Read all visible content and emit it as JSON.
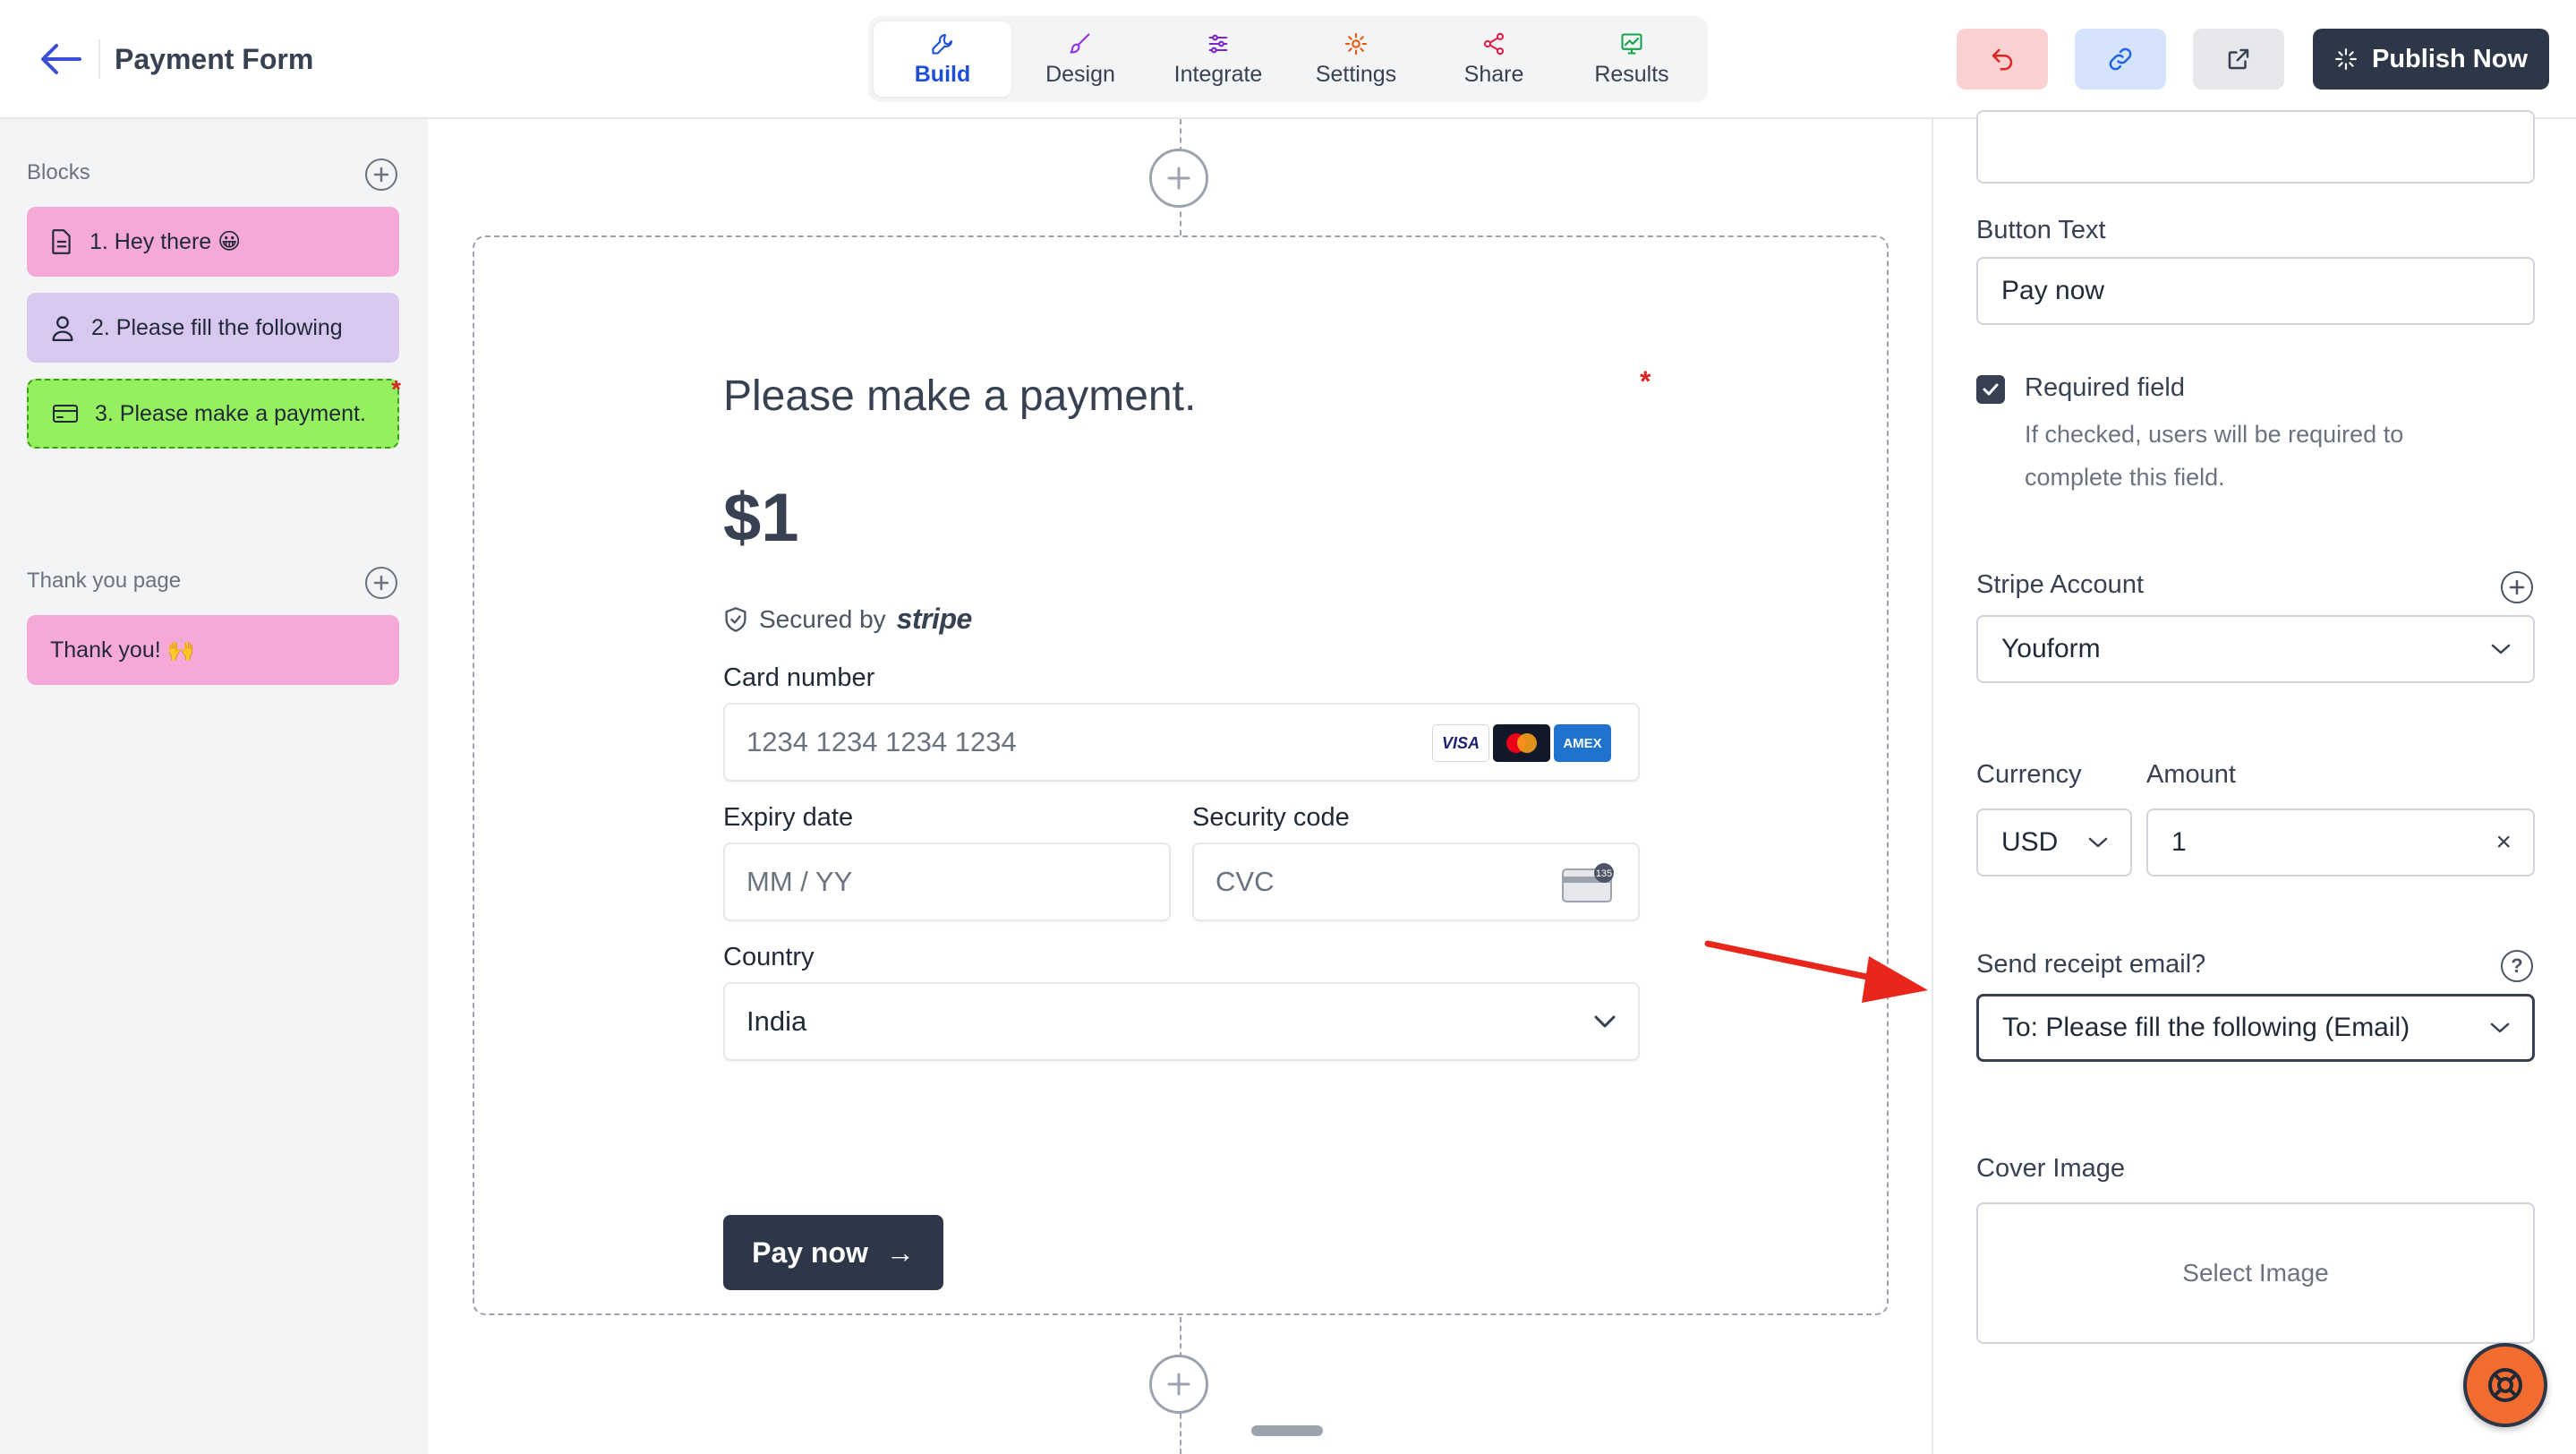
{
  "header": {
    "title": "Payment Form",
    "tabs": [
      {
        "label": "Build",
        "icon": "wrench-icon",
        "active": true
      },
      {
        "label": "Design",
        "icon": "brush-icon",
        "active": false
      },
      {
        "label": "Integrate",
        "icon": "sliders-icon",
        "active": false
      },
      {
        "label": "Settings",
        "icon": "gear-icon",
        "active": false
      },
      {
        "label": "Share",
        "icon": "share-icon",
        "active": false
      },
      {
        "label": "Results",
        "icon": "chart-icon",
        "active": false
      }
    ],
    "publish_label": "Publish Now"
  },
  "sidebar": {
    "blocks_heading": "Blocks",
    "blocks": [
      {
        "label": "1. Hey there 😀",
        "icon": "document-icon",
        "color": "#f6a8d7"
      },
      {
        "label": "2. Please fill the following",
        "icon": "user-icon",
        "color": "#d8c8ef"
      },
      {
        "label": "3. Please make a payment.",
        "icon": "credit-card-icon",
        "color": "#95ef5f",
        "required_marker": "*"
      }
    ],
    "thankyou_heading": "Thank you page",
    "thankyou_blocks": [
      {
        "label": "Thank you! 🙌",
        "color": "#f6a8d7"
      }
    ]
  },
  "canvas": {
    "question": "Please make a payment.",
    "required_marker": "*",
    "amount": "$1",
    "secured_prefix": "Secured by",
    "secured_brand": "stripe",
    "card_number_label": "Card number",
    "card_number_placeholder": "1234 1234 1234 1234",
    "card_brands": [
      "VISA",
      "Mastercard",
      "AMEX"
    ],
    "expiry_label": "Expiry date",
    "expiry_placeholder": "MM / YY",
    "security_label": "Security code",
    "security_placeholder": "CVC",
    "cvc_badge": "135",
    "country_label": "Country",
    "country_value": "India",
    "pay_button": "Pay now",
    "pay_arrow": "→"
  },
  "panel": {
    "button_text_label": "Button Text",
    "button_text_value": "Pay now",
    "required_label": "Required field",
    "required_checked": true,
    "required_help": "If checked, users will be required to complete this field.",
    "stripe_account_label": "Stripe Account",
    "stripe_account_value": "Youform",
    "currency_label": "Currency",
    "currency_value": "USD",
    "amount_label": "Amount",
    "amount_value": "1",
    "clear_symbol": "×",
    "receipt_label": "Send receipt email?",
    "receipt_help_symbol": "?",
    "receipt_value": "To: Please fill the following (Email)",
    "cover_image_label": "Cover Image",
    "select_image": "Select Image"
  },
  "colors": {
    "accent": "#1d4ed8",
    "dark_button": "#2d3748",
    "required": "#dc2626",
    "annotation_arrow": "#e8261c",
    "help_fab": "#f26b2f"
  }
}
